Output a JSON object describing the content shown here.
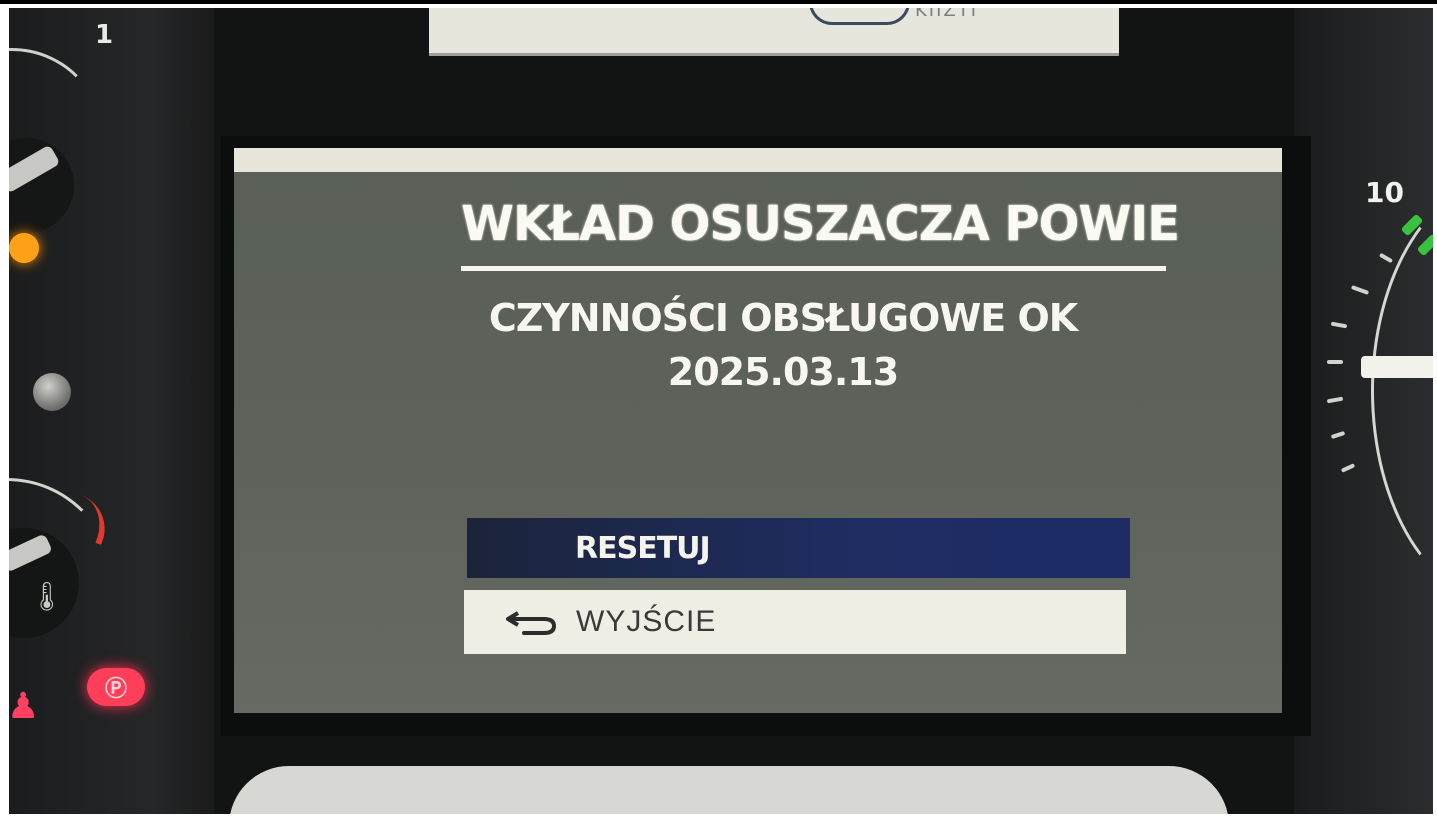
{
  "cluster": {
    "left_gauge_number": "1",
    "right_gauge_number": "10",
    "top_strip_fragment": "KIIZTI"
  },
  "screen": {
    "title": "WKŁAD OSUSZACZA POWIE",
    "status": "CZYNNOŚCI OBSŁUGOWE OK",
    "date": "2025.03.13",
    "menu": {
      "reset_label": "RESETUJ",
      "exit_label": "WYJŚCIE",
      "selected": "RESETUJ"
    }
  },
  "icons": [
    "back-arrow-icon",
    "coolant-temperature-icon",
    "parking-brake-icon",
    "seatbelt-warning-icon",
    "warning-lamp-icon"
  ],
  "colors": {
    "screen_background": "#5d625a",
    "selected_item": "#1f2d63",
    "unselected_item": "#efeee4",
    "warning_orange": "#ffa21a",
    "parking_red": "#ff3f5a",
    "green_marker": "#39c23d"
  }
}
